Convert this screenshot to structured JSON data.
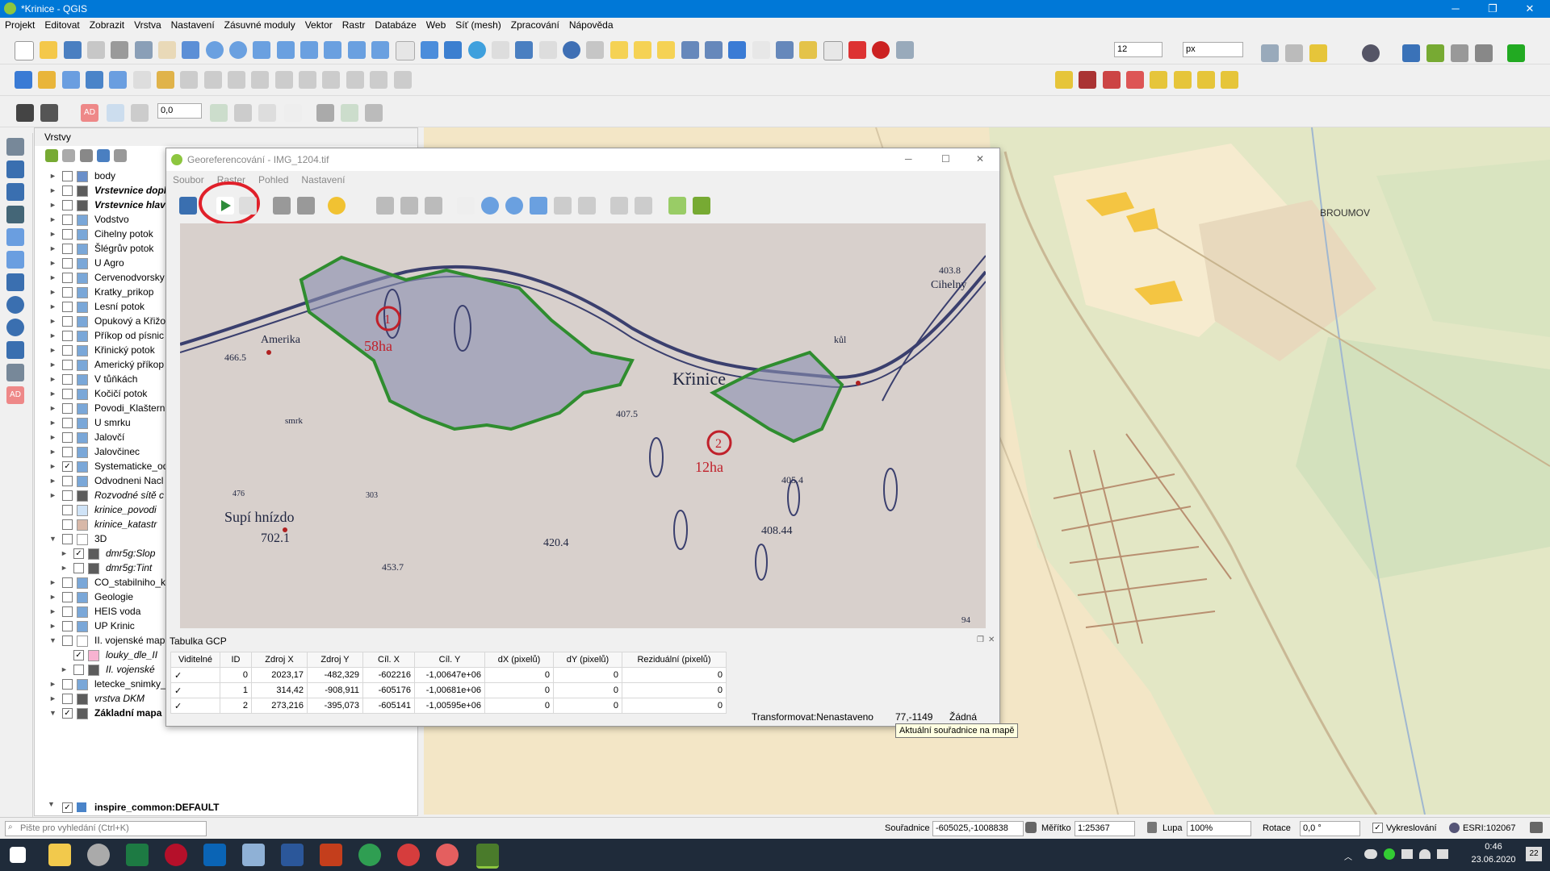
{
  "window": {
    "title": "*Krinice - QGIS"
  },
  "menu": [
    "Projekt",
    "Editovat",
    "Zobrazit",
    "Vrstva",
    "Nastavení",
    "Zásuvné moduly",
    "Vektor",
    "Rastr",
    "Databáze",
    "Web",
    "Síť (mesh)",
    "Zpracování",
    "Nápověda"
  ],
  "toolbar": {
    "font_size": "12",
    "unit": "px",
    "offset_value": "0,0"
  },
  "layers_panel": {
    "title": "Vrstvy",
    "items": [
      {
        "label": "body",
        "checked": false,
        "italic": false,
        "bold": false,
        "expand": "►"
      },
      {
        "label": "Vrstevnice dopl",
        "checked": false,
        "italic": true,
        "bold": true,
        "expand": "►"
      },
      {
        "label": "Vrstevnice hlav",
        "checked": false,
        "italic": true,
        "bold": true,
        "expand": "►"
      },
      {
        "label": "Vodstvo",
        "checked": false,
        "italic": false,
        "bold": false,
        "expand": "►"
      },
      {
        "label": "Cihelny potok",
        "checked": false,
        "italic": false,
        "bold": false,
        "expand": "►"
      },
      {
        "label": "Šlégrův potok",
        "checked": false,
        "italic": false,
        "bold": false,
        "expand": "►"
      },
      {
        "label": "U Agro",
        "checked": false,
        "italic": false,
        "bold": false,
        "expand": "►"
      },
      {
        "label": "Cervenodvorsky",
        "checked": false,
        "italic": false,
        "bold": false,
        "expand": "►"
      },
      {
        "label": "Kratky_prikop",
        "checked": false,
        "italic": false,
        "bold": false,
        "expand": "►"
      },
      {
        "label": "Lesní potok",
        "checked": false,
        "italic": false,
        "bold": false,
        "expand": "►"
      },
      {
        "label": "Opukový a Křižo",
        "checked": false,
        "italic": false,
        "bold": false,
        "expand": "►"
      },
      {
        "label": "Příkop od písnic",
        "checked": false,
        "italic": false,
        "bold": false,
        "expand": "►"
      },
      {
        "label": "Křinický potok",
        "checked": false,
        "italic": false,
        "bold": false,
        "expand": "►"
      },
      {
        "label": "Americký příkop",
        "checked": false,
        "italic": false,
        "bold": false,
        "expand": "►"
      },
      {
        "label": "V tůňkách",
        "checked": false,
        "italic": false,
        "bold": false,
        "expand": "►"
      },
      {
        "label": "Kočičí potok",
        "checked": false,
        "italic": false,
        "bold": false,
        "expand": "►"
      },
      {
        "label": "Povodi_Klaštern",
        "checked": false,
        "italic": false,
        "bold": false,
        "expand": "►"
      },
      {
        "label": "U smrku",
        "checked": false,
        "italic": false,
        "bold": false,
        "expand": "►"
      },
      {
        "label": "Jalovčí",
        "checked": false,
        "italic": false,
        "bold": false,
        "expand": "►"
      },
      {
        "label": "Jalovčinec",
        "checked": false,
        "italic": false,
        "bold": false,
        "expand": "►"
      },
      {
        "label": "Systematicke_od",
        "checked": true,
        "italic": false,
        "bold": false,
        "expand": "►"
      },
      {
        "label": "Odvodneni Nacl",
        "checked": false,
        "italic": false,
        "bold": false,
        "expand": "►"
      },
      {
        "label": "Rozvodné sítě c",
        "checked": false,
        "italic": true,
        "bold": false,
        "expand": "►"
      },
      {
        "label": "krinice_povodi",
        "checked": false,
        "italic": true,
        "bold": false,
        "expand": ""
      },
      {
        "label": "krinice_katastr",
        "checked": false,
        "italic": true,
        "bold": false,
        "expand": ""
      },
      {
        "label": "3D",
        "checked": false,
        "italic": false,
        "bold": false,
        "expand": "▼"
      },
      {
        "label": "dmr5g:Slop",
        "checked": true,
        "italic": true,
        "bold": false,
        "expand": "►"
      },
      {
        "label": "dmr5g:Tint",
        "checked": false,
        "italic": true,
        "bold": false,
        "expand": "►"
      },
      {
        "label": "CO_stabilniho_k",
        "checked": false,
        "italic": false,
        "bold": false,
        "expand": "►"
      },
      {
        "label": "Geologie",
        "checked": false,
        "italic": false,
        "bold": false,
        "expand": "►"
      },
      {
        "label": "HEIS voda",
        "checked": false,
        "italic": false,
        "bold": false,
        "expand": "►"
      },
      {
        "label": "UP Krinic",
        "checked": false,
        "italic": false,
        "bold": false,
        "expand": "►"
      },
      {
        "label": "II. vojenské map",
        "checked": false,
        "italic": false,
        "bold": false,
        "expand": "▼"
      },
      {
        "label": "louky_dle_II",
        "checked": true,
        "italic": true,
        "bold": false,
        "expand": ""
      },
      {
        "label": "II. vojenské",
        "checked": false,
        "italic": true,
        "bold": false,
        "expand": "►"
      },
      {
        "label": "letecke_snimky_",
        "checked": false,
        "italic": false,
        "bold": false,
        "expand": "►"
      },
      {
        "label": "vrstva DKM",
        "checked": false,
        "italic": true,
        "bold": false,
        "expand": "►"
      },
      {
        "label": "Základní mapa",
        "checked": true,
        "italic": false,
        "bold": true,
        "expand": "▼"
      }
    ],
    "bottom_item": "inspire_common:DEFAULT"
  },
  "georef": {
    "title": "Georeferencování - IMG_1204.tif",
    "menu": [
      "Soubor",
      "Raster",
      "Pohled",
      "Nastavení"
    ],
    "map_labels": {
      "krinice": "Křinice",
      "amerika": "Amerika",
      "supi": "Supí hnízdo",
      "smrk": "smrk",
      "cihelny": "Cihelny",
      "kul": "kůl",
      "area1": "58ha",
      "area2": "12ha",
      "n1": "1",
      "n2": "2",
      "e1": "466.5",
      "e2": "702.1",
      "e3": "453.7",
      "e4": "420.4",
      "e5": "408.44",
      "e6": "407.5",
      "e7": "405.4",
      "e8": "403.8",
      "e9": "303",
      "e10": "94",
      "e11": "476"
    },
    "gcp_title": "Tabulka GCP",
    "gcp_headers": [
      "Viditelné",
      "ID",
      "Zdroj X",
      "Zdroj Y",
      "Cíl. X",
      "Cíl. Y",
      "dX (pixelů)",
      "dY (pixelů)",
      "Reziduální (pixelů)"
    ],
    "gcp_rows": [
      [
        "✓",
        "0",
        "2023,17",
        "-482,329",
        "-602216",
        "-1,00647e+06",
        "0",
        "0",
        "0"
      ],
      [
        "✓",
        "1",
        "314,42",
        "-908,911",
        "-605176",
        "-1,00681e+06",
        "0",
        "0",
        "0"
      ],
      [
        "✓",
        "2",
        "273,216",
        "-395,073",
        "-605141",
        "-1,00595e+06",
        "0",
        "0",
        "0"
      ]
    ],
    "status_transform": "Transformovat:Nenastaveno",
    "status_coords": "77,-1149",
    "status_none": "Žádná",
    "tooltip": "Aktuální souřadnice na mapě"
  },
  "statusbar": {
    "search_placeholder": "Pište pro vyhledání (Ctrl+K)",
    "coords_label": "Souřadnice",
    "coords_value": "-605025,-1008838",
    "scale_label": "Měřítko",
    "scale_value": "1:25367",
    "lupa_label": "Lupa",
    "lupa_value": "100%",
    "rotation_label": "Rotace",
    "rotation_value": "0,0 °",
    "render_label": "Vykreslování",
    "crs": "ESRI:102067"
  },
  "map": {
    "broumov": "BROUMOV"
  },
  "taskbar": {
    "time": "0:46",
    "date": "23.06.2020",
    "notif": "22"
  }
}
